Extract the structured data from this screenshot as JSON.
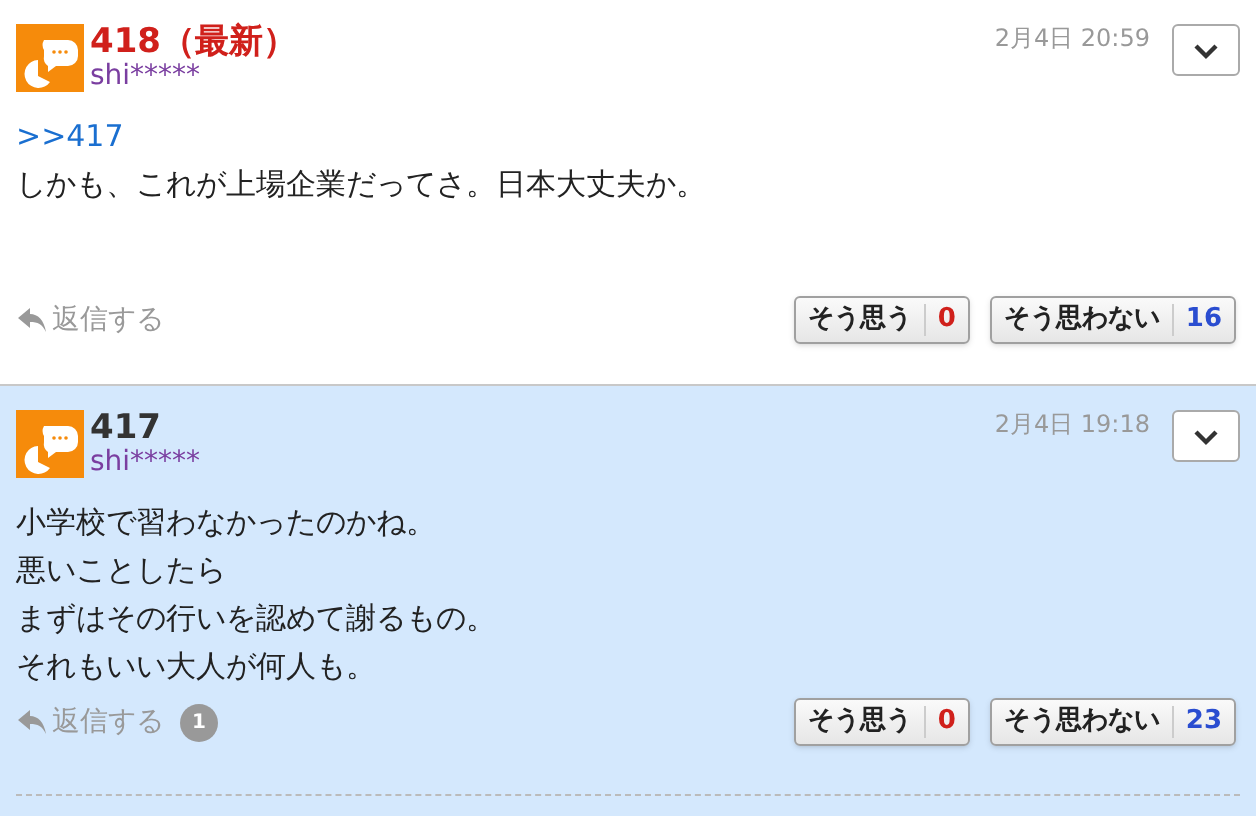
{
  "comments": [
    {
      "title": "418（最新）",
      "latest": true,
      "highlighted": false,
      "user": "shi*****",
      "date": "2月4日 20:59",
      "anchor": ">>417",
      "lines": [
        "しかも、これが上場企業だってさ。日本大丈夫か。"
      ],
      "reply": "返信する",
      "agree": {
        "label": "そう思う",
        "count": "0"
      },
      "disagree": {
        "label": "そう思わない",
        "count": "16"
      }
    },
    {
      "title": "417",
      "latest": false,
      "highlighted": true,
      "user": "shi*****",
      "date": "2月4日 19:18",
      "lines": [
        "小学校で習わなかったのかね。",
        "悪いことしたら",
        "まずはその行いを認めて謝るもの。",
        "それもいい大人が何人も。"
      ],
      "reply": "返信する",
      "reply_count": "1",
      "agree": {
        "label": "そう思う",
        "count": "0"
      },
      "disagree": {
        "label": "そう思わない",
        "count": "23"
      }
    }
  ]
}
